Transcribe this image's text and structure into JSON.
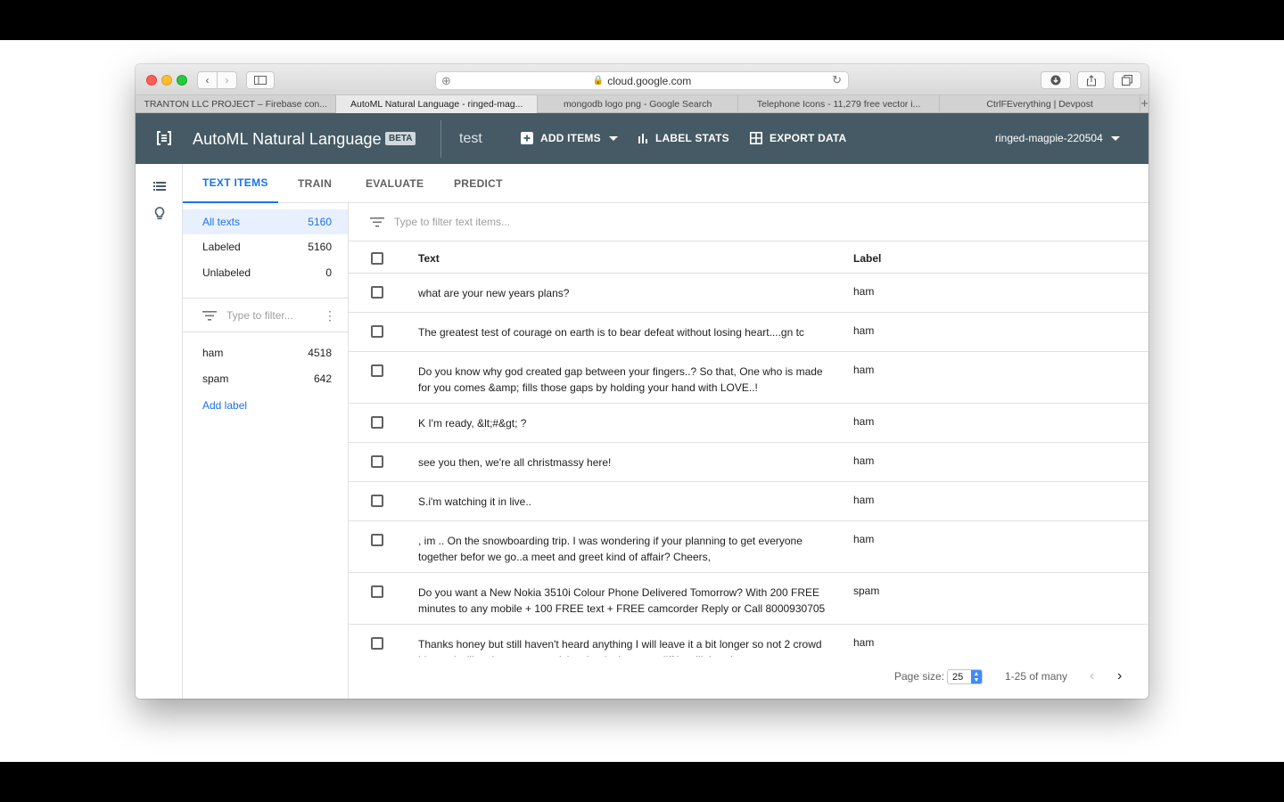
{
  "browser": {
    "url": "cloud.google.com",
    "tabs": [
      {
        "label": "TRANTON LLC PROJECT – Firebase con..."
      },
      {
        "label": "AutoML Natural Language - ringed-mag..."
      },
      {
        "label": "mongodb logo png - Google Search"
      },
      {
        "label": "Telephone Icons - 11,279 free vector i..."
      },
      {
        "label": "CtrlFEverything | Devpost"
      }
    ],
    "new_tab": "+"
  },
  "header": {
    "title": "AutoML Natural Language",
    "badge": "BETA",
    "dataset": "test",
    "add_items": "ADD ITEMS",
    "label_stats": "LABEL STATS",
    "export_data": "EXPORT DATA",
    "project": "ringed-magpie-220504"
  },
  "tabs": {
    "text_items": "TEXT ITEMS",
    "train": "TRAIN",
    "evaluate": "EVALUATE",
    "predict": "PREDICT"
  },
  "filters": {
    "all_texts": {
      "label": "All texts",
      "count": "5160"
    },
    "labeled": {
      "label": "Labeled",
      "count": "5160"
    },
    "unlabeled": {
      "label": "Unlabeled",
      "count": "0"
    },
    "filter_placeholder": "Type to filter...",
    "labels": [
      {
        "label": "ham",
        "count": "4518"
      },
      {
        "label": "spam",
        "count": "642"
      }
    ],
    "add_label": "Add label"
  },
  "table": {
    "search_placeholder": "Type to filter text items...",
    "col_text": "Text",
    "col_label": "Label",
    "rows": [
      {
        "text": "what are your new years plans?",
        "label": "ham"
      },
      {
        "text": "The greatest test of courage on earth is to bear defeat without losing heart....gn tc",
        "label": "ham"
      },
      {
        "text": "Do you know why god created gap between your fingers..? So that, One who is made for you comes &amp; fills those gaps by holding your hand with LOVE..!",
        "label": "ham"
      },
      {
        "text": "K I'm ready, &lt;#&gt; ?",
        "label": "ham"
      },
      {
        "text": "see you then, we're all christmassy here!",
        "label": "ham"
      },
      {
        "text": "S.i'm watching it in live..",
        "label": "ham"
      },
      {
        "text": ", im .. On the snowboarding trip. I was wondering if your planning to get everyone together befor we go..a meet and greet kind of affair? Cheers,",
        "label": "ham"
      },
      {
        "text": "Do you want a New Nokia 3510i Colour Phone Delivered Tomorrow? With 200 FREE minutes to any mobile + 100 FREE text + FREE camcorder Reply or Call 8000930705",
        "label": "spam"
      },
      {
        "text": "Thanks honey but still haven't heard anything I will leave it a bit longer so not 2 crowd him and will try later - great advice thanks hope cardiff is still there!",
        "label": "ham"
      }
    ]
  },
  "pager": {
    "page_size_label": "Page size:",
    "page_size": "25",
    "range": "1-25 of many"
  }
}
